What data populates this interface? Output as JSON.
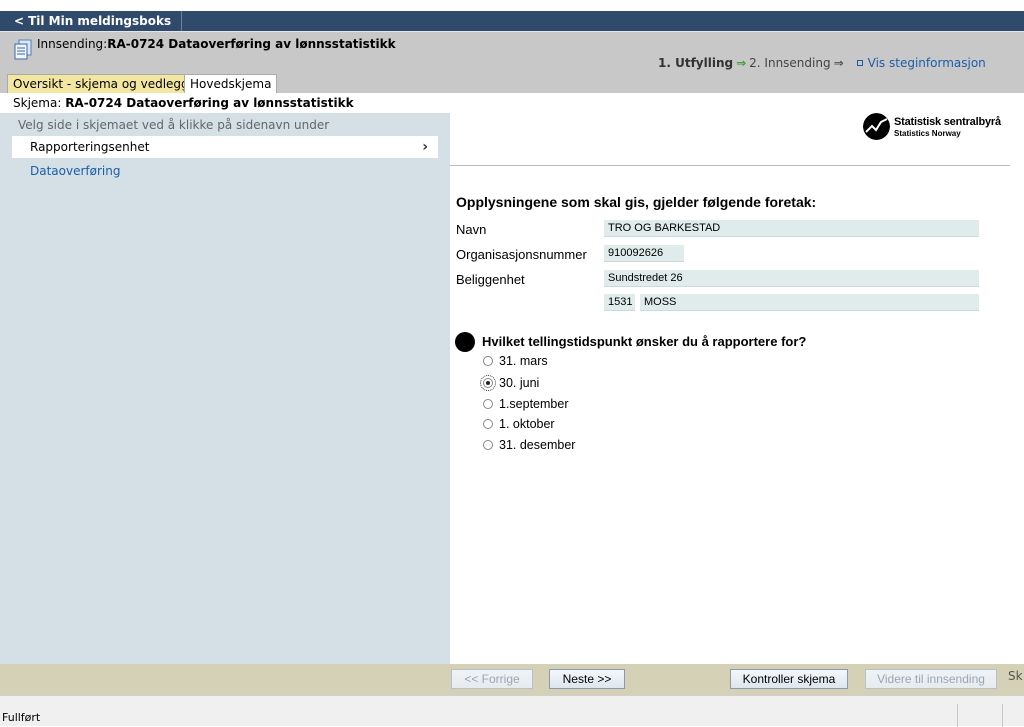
{
  "topbar": {
    "back_label": "Til Min meldingsboks",
    "back_icon": "chevron-left-icon"
  },
  "header": {
    "title_prefix": "Innsending:",
    "title_main": "RA-0724 Dataoverføring av lønnsstatistikk",
    "steps": {
      "step1": "1. Utfylling",
      "step2": "2. Innsending",
      "vis": "Vis steginformasjon"
    },
    "tabs": [
      "Oversikt - skjema og vedlegg",
      "Hovedskjema"
    ]
  },
  "schema_line": {
    "prefix": "Skjema: ",
    "name": "RA-0724 Dataoverføring av lønnsstatistikk"
  },
  "leftnav": {
    "hint": "Velg side i skjemaet ved å klikke på sidenavn under",
    "items": [
      {
        "label": "Rapporteringsenhet",
        "active": true
      },
      {
        "label": "Dataoverføring",
        "active": false
      }
    ]
  },
  "logo": {
    "line1": "Statistisk sentralbyrå",
    "line2": "Statistics Norway"
  },
  "form": {
    "heading": "Opplysningene som skal gis, gjelder følgende foretak:",
    "fields": {
      "navn_label": "Navn",
      "navn_value": "TRO OG BARKESTAD",
      "orgnr_label": "Organisasjonsnummer",
      "orgnr_value": "910092626",
      "beliggenhet_label": "Beliggenhet",
      "address_value": "Sundstredet 26",
      "postnr_value": "1531",
      "poststed_value": "MOSS"
    },
    "question": "Hvilket tellingstidspunkt ønsker du å rapportere for?",
    "options": [
      "31. mars",
      "30. juni",
      "1.september",
      "1. oktober",
      "31. desember"
    ],
    "selected": "30. juni"
  },
  "footer": {
    "prev": "<< Forrige",
    "next": "Neste >>",
    "check": "Kontroller skjema",
    "submit": "Videre til innsending",
    "sk": "Sk"
  },
  "statusbar": {
    "text": "Fullført"
  },
  "colors": {
    "topbar": "#2f4a6a",
    "header": "#c8c8c8",
    "leftnav": "#d4dfe6",
    "footer": "#d4d1b6",
    "link": "#1a5ea8",
    "field": "#e0ebeb"
  }
}
